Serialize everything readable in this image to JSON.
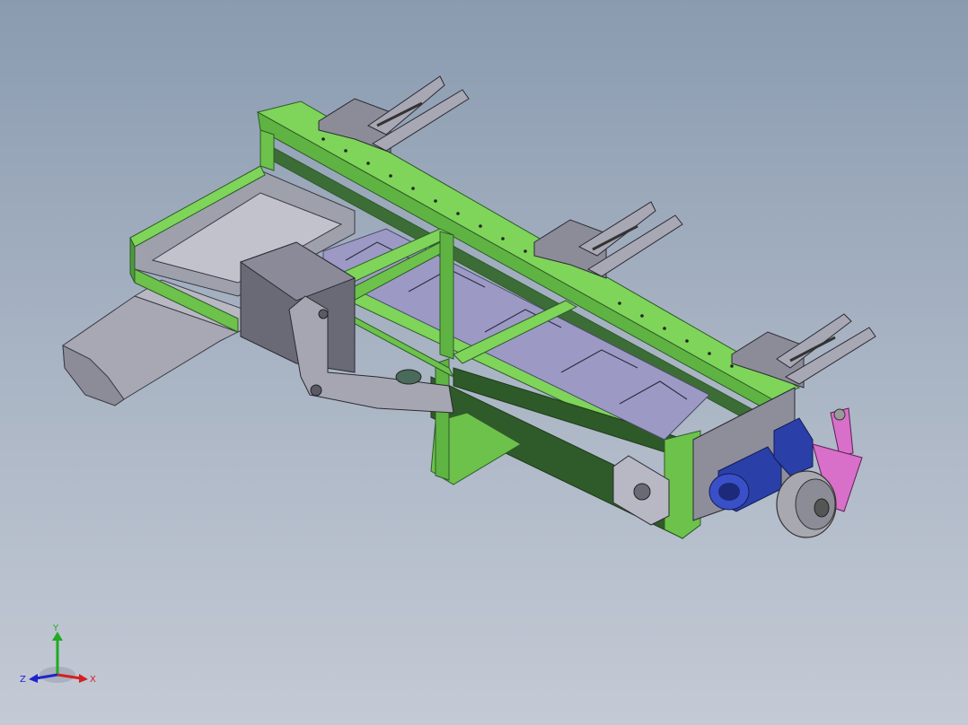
{
  "viewport": {
    "background_top": "#8a9bb0",
    "background_bottom": "#c4cad5"
  },
  "model": {
    "frame_color": "#6cc24a",
    "frame_dark": "#2f5a2a",
    "steel_color": "#9a9aa8",
    "belt_color": "#9c9ac4",
    "motor_color": "#2b3fa8",
    "bracket_color": "#d86fc8",
    "wheel_color": "#a8a8b0"
  },
  "triad": {
    "icon": "coordinate-triad-icon",
    "x_label": "X",
    "y_label": "Y",
    "z_label": "Z",
    "x_color": "#d42020",
    "y_color": "#22aa22",
    "z_color": "#2222cc"
  }
}
